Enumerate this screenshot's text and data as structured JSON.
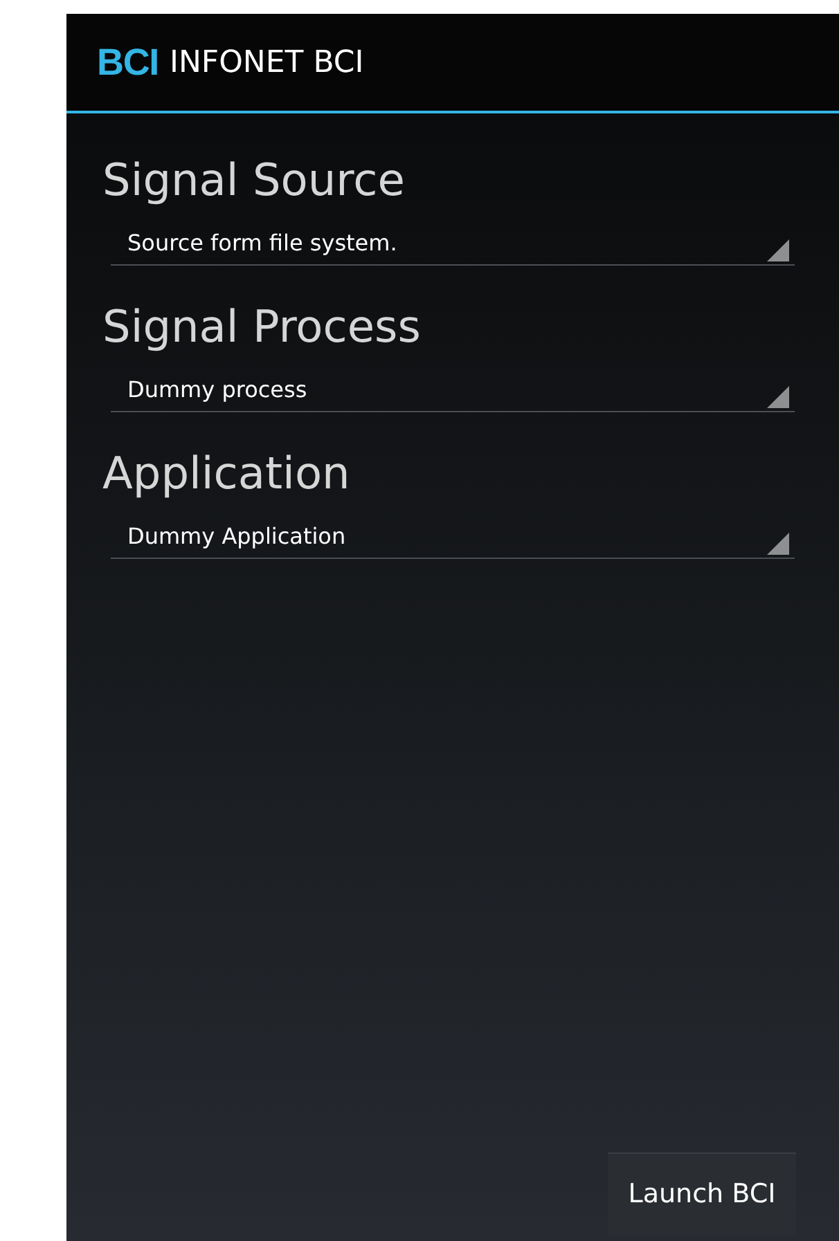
{
  "action_bar": {
    "logo": "BCI",
    "title": "INFONET BCI"
  },
  "sections": [
    {
      "heading": "Signal Source",
      "value": "Source form file system."
    },
    {
      "heading": "Signal Process",
      "value": "Dummy process"
    },
    {
      "heading": "Application",
      "value": "Dummy Application"
    }
  ],
  "launch_button": "Launch BCI"
}
